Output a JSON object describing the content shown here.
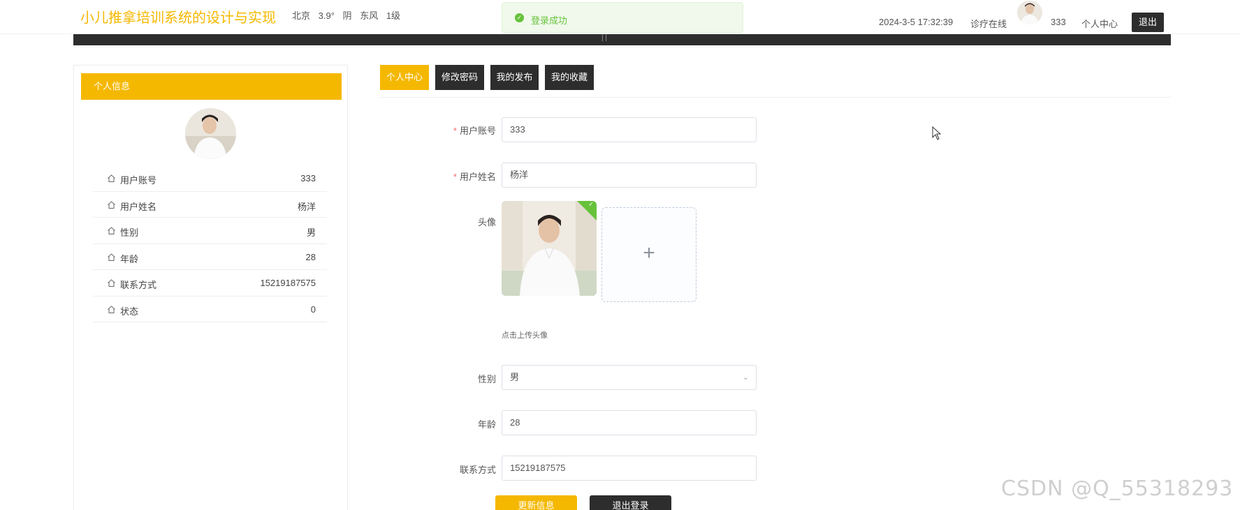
{
  "header": {
    "site_title": "小儿推拿培训系统的设计与实现",
    "weather": {
      "city": "北京",
      "temp": "3.9°",
      "condition": "阴",
      "wind": "东风",
      "level": "1级"
    },
    "toast": "登录成功",
    "datetime": "2024-3-5 17:32:39",
    "online_label": "诊疗在线",
    "username": "333",
    "personal_center": "个人中心",
    "logout": "退出"
  },
  "sidebar": {
    "title": "个人信息",
    "items": [
      {
        "label": "用户账号",
        "value": "333"
      },
      {
        "label": "用户姓名",
        "value": "杨洋"
      },
      {
        "label": "性别",
        "value": "男"
      },
      {
        "label": "年龄",
        "value": "28"
      },
      {
        "label": "联系方式",
        "value": "15219187575"
      },
      {
        "label": "状态",
        "value": "0"
      }
    ]
  },
  "tabs": [
    {
      "label": "个人中心",
      "active": true
    },
    {
      "label": "修改密码",
      "active": false
    },
    {
      "label": "我的发布",
      "active": false
    },
    {
      "label": "我的收藏",
      "active": false
    }
  ],
  "form": {
    "account": {
      "label": "用户账号",
      "value": "333"
    },
    "name": {
      "label": "用户姓名",
      "value": "杨洋"
    },
    "avatar": {
      "label": "头像",
      "hint": "点击上传头像",
      "plus": "+"
    },
    "gender": {
      "label": "性别",
      "value": "男"
    },
    "age": {
      "label": "年龄",
      "value": "28"
    },
    "phone": {
      "label": "联系方式",
      "value": "15219187575"
    },
    "update_button": "更新信息",
    "logout_button": "退出登录"
  },
  "watermark": "CSDN @Q_55318293",
  "colors": {
    "accent": "#f5b800",
    "dark": "#2d2d2d",
    "success": "#67c23a"
  }
}
